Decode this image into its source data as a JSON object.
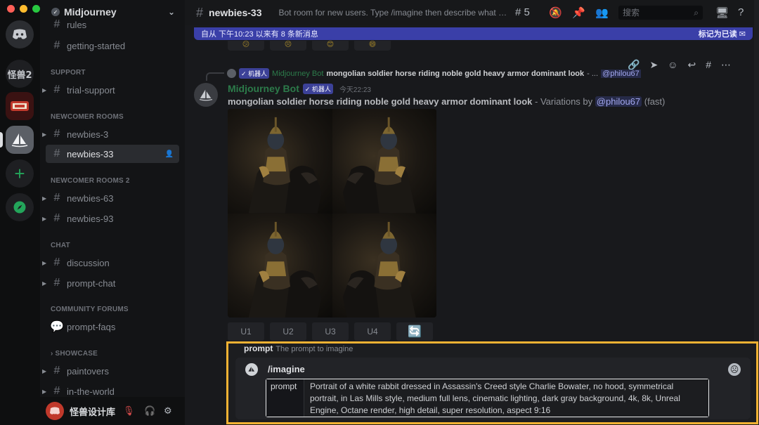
{
  "colors": {
    "accent": "#5865f2",
    "highlight_border": "#f2b233",
    "bot_green": "#2c7b4a",
    "new_banner": "#3a3fa8"
  },
  "rail": {
    "servers": [
      {
        "name": "discord-home-icon"
      },
      {
        "label": "怪兽2"
      },
      {
        "name": "server-logo-icon"
      },
      {
        "name": "midjourney-icon"
      },
      {
        "name": "add-server-icon"
      },
      {
        "name": "explore-icon"
      }
    ]
  },
  "sidebar": {
    "guild_name": "Midjourney",
    "top_partial": "rules",
    "categories": {
      "support": "SUPPORT",
      "newcomer": "NEWCOMER ROOMS",
      "newcomer2": "NEWCOMER ROOMS 2",
      "chat": "CHAT",
      "forums": "COMMUNITY FORUMS",
      "showcase": "SHOWCASE"
    },
    "channels": {
      "getting_started": "getting-started",
      "trial_support": "trial-support",
      "newbies_3": "newbies-3",
      "newbies_33": "newbies-33",
      "newbies_63": "newbies-63",
      "newbies_93": "newbies-93",
      "discussion": "discussion",
      "prompt_chat": "prompt-chat",
      "prompt_faqs": "prompt-faqs",
      "paintovers": "paintovers",
      "in_the_world": "in-the-world"
    },
    "user": {
      "name": "怪兽设计库"
    }
  },
  "topbar": {
    "channel": "newbies-33",
    "topic": "Bot room for new users. Type /imagine then describe what you...",
    "thread_count": "5",
    "search_placeholder": "搜索"
  },
  "banner": {
    "text": "自从 下午10:23 以来有 8 条新消息",
    "action": "标记为已读"
  },
  "reply": {
    "bot_badge": "✓ 机器人",
    "author": "Midjourney Bot",
    "text": "mongolian soldier horse riding noble gold heavy armor dominant look",
    "suffix": "- ...",
    "mention": "@philou67"
  },
  "message": {
    "author": "Midjourney Bot",
    "bot_badge": "✓ 机器人",
    "time": "今天22:23",
    "prompt": "mongolian soldier horse riding noble gold heavy armor dominant look",
    "variation_text": "- Variations by",
    "mention": "@philou67",
    "speed": "(fast)"
  },
  "buttons": {
    "u1": "U1",
    "u2": "U2",
    "u3": "U3",
    "u4": "U4",
    "reroll": "🔄"
  },
  "composer": {
    "hint_label": "prompt",
    "hint_text": "The prompt to imagine",
    "command": "/imagine",
    "option_label": "prompt",
    "option_value": "Portrait of a white rabbit dressed in Assassin's Creed style Charlie Bowater, no hood, symmetrical portrait, in Las Mills style, medium full lens, cinematic lighting, dark gray background, 4k, 8k, Unreal Engine, Octane render, high detail, super resolution, aspect 9:16"
  }
}
